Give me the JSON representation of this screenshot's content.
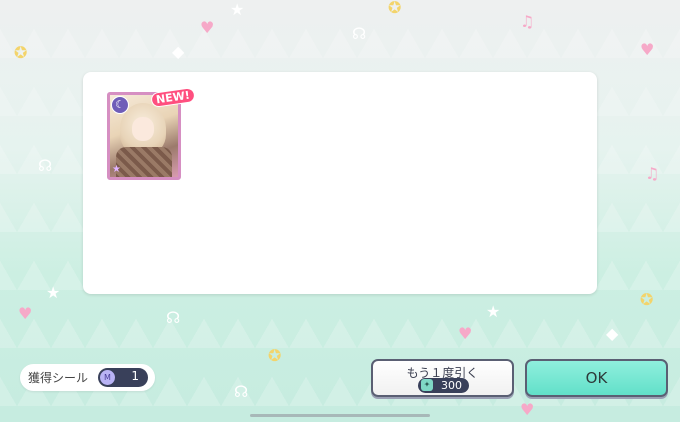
{
  "result_panel": {
    "card": {
      "new_badge": "NEW!",
      "attribute_icon": "moon-icon"
    }
  },
  "seal": {
    "label": "獲得シール",
    "count": "1",
    "icon": "seal-icon"
  },
  "draw_again_button": {
    "label": "もう１度引く",
    "cost": "300",
    "cost_icon": "star-gem-icon"
  },
  "ok_button": {
    "label": "OK"
  },
  "colors": {
    "ok_button": "#62e0c9",
    "pill_dark": "#39405a",
    "new_badge": "#ff4f7f",
    "card_frame": "#d68fc2"
  }
}
